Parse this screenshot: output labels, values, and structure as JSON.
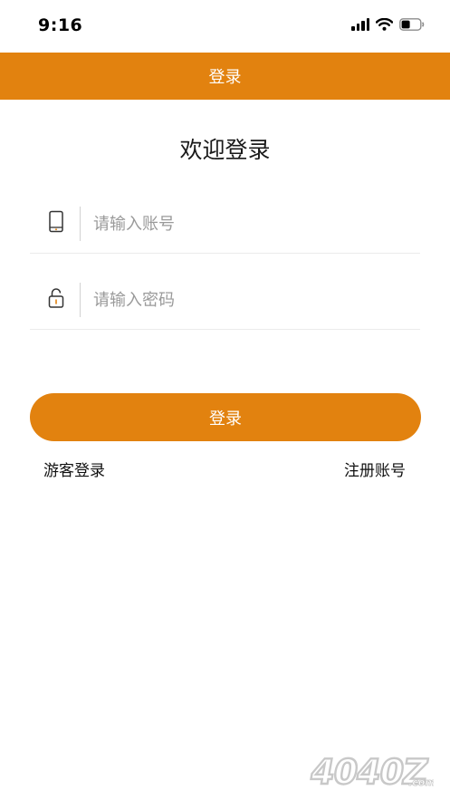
{
  "status_bar": {
    "time": "9:16"
  },
  "header": {
    "title": "登录"
  },
  "welcome": "欢迎登录",
  "form": {
    "account_placeholder": "请输入账号",
    "account_value": "",
    "password_placeholder": "请输入密码",
    "password_value": ""
  },
  "actions": {
    "login_label": "登录",
    "guest_login": "游客登录",
    "register": "注册账号"
  },
  "watermark": {
    "logo_text": "4040Z",
    "suffix": ".com"
  },
  "colors": {
    "accent": "#e2820f",
    "divider": "#ebebeb",
    "placeholder": "#9a9a9a"
  },
  "icons": [
    "signal-icon",
    "wifi-icon",
    "battery-icon",
    "phone-icon",
    "lock-icon"
  ]
}
